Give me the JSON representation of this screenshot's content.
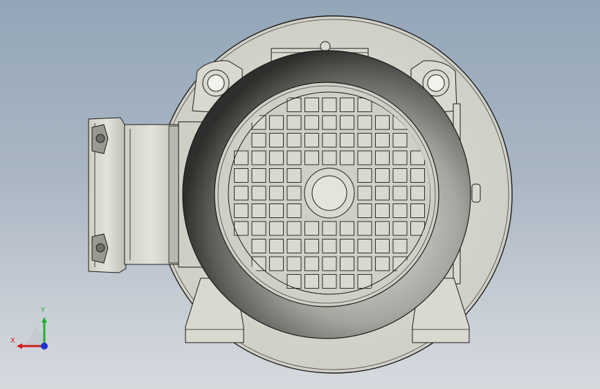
{
  "view": {
    "background_top": "#93a6b8",
    "background_bottom": "#d6dadf",
    "part_color": "#d9d9cf",
    "edge_color": "#1a1a1a"
  },
  "triad": {
    "x_label": "X",
    "y_label": "Y",
    "x_color": "#d11b1b",
    "y_color": "#1fae2f",
    "z_color": "#1b2fd1"
  }
}
